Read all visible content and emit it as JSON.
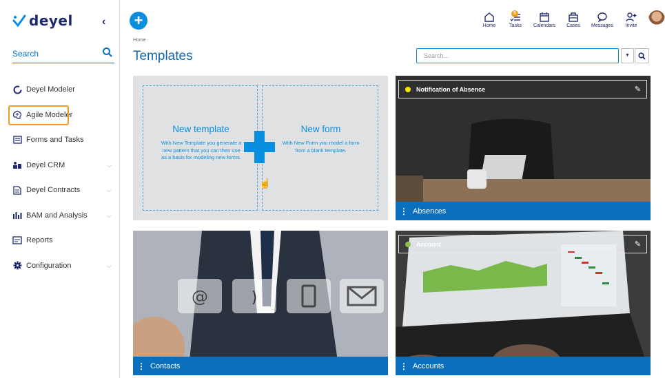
{
  "app": {
    "logo_text": "deyel",
    "collapse_label": "‹",
    "accent_color": "#0a8fe0",
    "highlight_color": "#f29b1d"
  },
  "sidebar": {
    "search_label": "Search",
    "items": [
      {
        "label": "Deyel Modeler",
        "icon": "circle-icon",
        "has_chevron": false
      },
      {
        "label": "Agile Modeler",
        "icon": "brain-icon",
        "has_chevron": false,
        "highlighted": true
      },
      {
        "label": "Forms and Tasks",
        "icon": "form-icon",
        "has_chevron": false
      },
      {
        "label": "Deyel CRM",
        "icon": "crm-icon",
        "has_chevron": true
      },
      {
        "label": "Deyel Contracts",
        "icon": "contract-icon",
        "has_chevron": true
      },
      {
        "label": "BAM and Analysis",
        "icon": "chart-icon",
        "has_chevron": true
      },
      {
        "label": "Reports",
        "icon": "report-icon",
        "has_chevron": false
      },
      {
        "label": "Configuration",
        "icon": "gear-icon",
        "has_chevron": true
      }
    ]
  },
  "topbar": {
    "add_label": "+",
    "actions": [
      {
        "label": "Home",
        "icon": "home-icon"
      },
      {
        "label": "Tasks",
        "icon": "tasks-icon",
        "badge": "5"
      },
      {
        "label": "Calendars",
        "icon": "calendar-icon"
      },
      {
        "label": "Cases",
        "icon": "briefcase-icon"
      },
      {
        "label": "Messages",
        "icon": "message-icon"
      },
      {
        "label": "Invite",
        "icon": "invite-icon"
      }
    ]
  },
  "page": {
    "breadcrumb": "Home",
    "title": "Templates",
    "search_placeholder": "Search..."
  },
  "new_card": {
    "template_title": "New template",
    "template_desc": "With New Template you generate a new pattern that you can then use as a basis for modeling new forms.",
    "form_title": "New form",
    "form_desc": "With New Form you model a form from a blank template."
  },
  "cards": [
    {
      "header": "Notification of Absence",
      "footer": "Absences",
      "dot_color": "#f5e600"
    },
    {
      "header": "",
      "footer": "Contacts",
      "dot_color": ""
    },
    {
      "header": "Account",
      "footer": "Accounts",
      "dot_color": "#8bc34a"
    }
  ]
}
